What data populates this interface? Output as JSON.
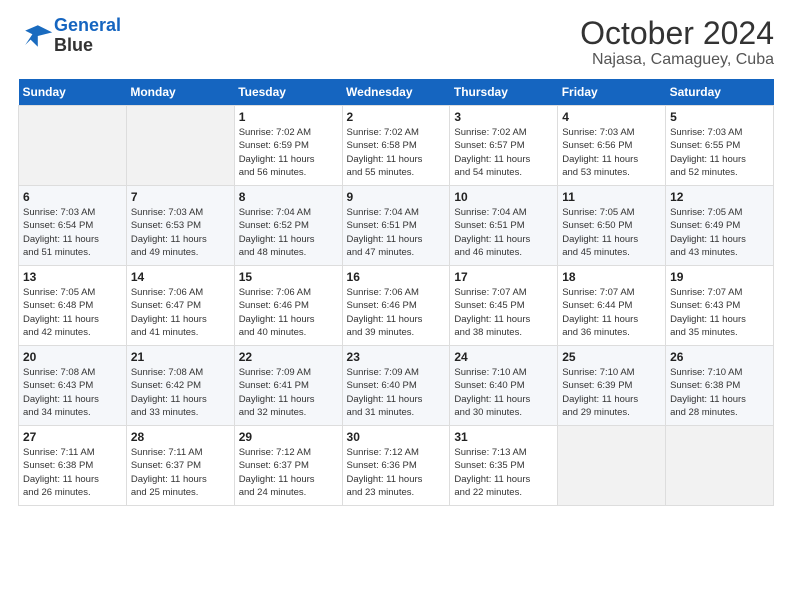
{
  "header": {
    "logo_line1": "General",
    "logo_line2": "Blue",
    "main_title": "October 2024",
    "subtitle": "Najasa, Camaguey, Cuba"
  },
  "days_of_week": [
    "Sunday",
    "Monday",
    "Tuesday",
    "Wednesday",
    "Thursday",
    "Friday",
    "Saturday"
  ],
  "weeks": [
    [
      {
        "day": "",
        "empty": true
      },
      {
        "day": "",
        "empty": true
      },
      {
        "day": "1",
        "rise": "7:02 AM",
        "set": "6:59 PM",
        "daylight": "11 hours and 56 minutes."
      },
      {
        "day": "2",
        "rise": "7:02 AM",
        "set": "6:58 PM",
        "daylight": "11 hours and 55 minutes."
      },
      {
        "day": "3",
        "rise": "7:02 AM",
        "set": "6:57 PM",
        "daylight": "11 hours and 54 minutes."
      },
      {
        "day": "4",
        "rise": "7:03 AM",
        "set": "6:56 PM",
        "daylight": "11 hours and 53 minutes."
      },
      {
        "day": "5",
        "rise": "7:03 AM",
        "set": "6:55 PM",
        "daylight": "11 hours and 52 minutes."
      }
    ],
    [
      {
        "day": "6",
        "rise": "7:03 AM",
        "set": "6:54 PM",
        "daylight": "11 hours and 51 minutes."
      },
      {
        "day": "7",
        "rise": "7:03 AM",
        "set": "6:53 PM",
        "daylight": "11 hours and 49 minutes."
      },
      {
        "day": "8",
        "rise": "7:04 AM",
        "set": "6:52 PM",
        "daylight": "11 hours and 48 minutes."
      },
      {
        "day": "9",
        "rise": "7:04 AM",
        "set": "6:51 PM",
        "daylight": "11 hours and 47 minutes."
      },
      {
        "day": "10",
        "rise": "7:04 AM",
        "set": "6:51 PM",
        "daylight": "11 hours and 46 minutes."
      },
      {
        "day": "11",
        "rise": "7:05 AM",
        "set": "6:50 PM",
        "daylight": "11 hours and 45 minutes."
      },
      {
        "day": "12",
        "rise": "7:05 AM",
        "set": "6:49 PM",
        "daylight": "11 hours and 43 minutes."
      }
    ],
    [
      {
        "day": "13",
        "rise": "7:05 AM",
        "set": "6:48 PM",
        "daylight": "11 hours and 42 minutes."
      },
      {
        "day": "14",
        "rise": "7:06 AM",
        "set": "6:47 PM",
        "daylight": "11 hours and 41 minutes."
      },
      {
        "day": "15",
        "rise": "7:06 AM",
        "set": "6:46 PM",
        "daylight": "11 hours and 40 minutes."
      },
      {
        "day": "16",
        "rise": "7:06 AM",
        "set": "6:46 PM",
        "daylight": "11 hours and 39 minutes."
      },
      {
        "day": "17",
        "rise": "7:07 AM",
        "set": "6:45 PM",
        "daylight": "11 hours and 38 minutes."
      },
      {
        "day": "18",
        "rise": "7:07 AM",
        "set": "6:44 PM",
        "daylight": "11 hours and 36 minutes."
      },
      {
        "day": "19",
        "rise": "7:07 AM",
        "set": "6:43 PM",
        "daylight": "11 hours and 35 minutes."
      }
    ],
    [
      {
        "day": "20",
        "rise": "7:08 AM",
        "set": "6:43 PM",
        "daylight": "11 hours and 34 minutes."
      },
      {
        "day": "21",
        "rise": "7:08 AM",
        "set": "6:42 PM",
        "daylight": "11 hours and 33 minutes."
      },
      {
        "day": "22",
        "rise": "7:09 AM",
        "set": "6:41 PM",
        "daylight": "11 hours and 32 minutes."
      },
      {
        "day": "23",
        "rise": "7:09 AM",
        "set": "6:40 PM",
        "daylight": "11 hours and 31 minutes."
      },
      {
        "day": "24",
        "rise": "7:10 AM",
        "set": "6:40 PM",
        "daylight": "11 hours and 30 minutes."
      },
      {
        "day": "25",
        "rise": "7:10 AM",
        "set": "6:39 PM",
        "daylight": "11 hours and 29 minutes."
      },
      {
        "day": "26",
        "rise": "7:10 AM",
        "set": "6:38 PM",
        "daylight": "11 hours and 28 minutes."
      }
    ],
    [
      {
        "day": "27",
        "rise": "7:11 AM",
        "set": "6:38 PM",
        "daylight": "11 hours and 26 minutes."
      },
      {
        "day": "28",
        "rise": "7:11 AM",
        "set": "6:37 PM",
        "daylight": "11 hours and 25 minutes."
      },
      {
        "day": "29",
        "rise": "7:12 AM",
        "set": "6:37 PM",
        "daylight": "11 hours and 24 minutes."
      },
      {
        "day": "30",
        "rise": "7:12 AM",
        "set": "6:36 PM",
        "daylight": "11 hours and 23 minutes."
      },
      {
        "day": "31",
        "rise": "7:13 AM",
        "set": "6:35 PM",
        "daylight": "11 hours and 22 minutes."
      },
      {
        "day": "",
        "empty": true
      },
      {
        "day": "",
        "empty": true
      }
    ]
  ],
  "labels": {
    "sunrise": "Sunrise:",
    "sunset": "Sunset:",
    "daylight": "Daylight:"
  }
}
